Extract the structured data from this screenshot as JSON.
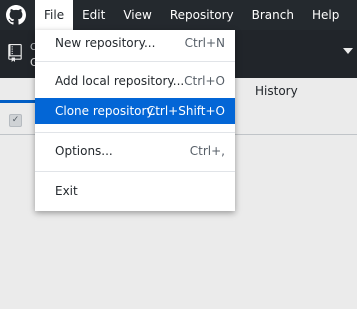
{
  "menubar": {
    "items": [
      {
        "label": "File"
      },
      {
        "label": "Edit"
      },
      {
        "label": "View"
      },
      {
        "label": "Repository"
      },
      {
        "label": "Branch"
      },
      {
        "label": "Help"
      }
    ]
  },
  "toolbar": {
    "repo_label": "C",
    "repo_name": "G"
  },
  "tabs": {
    "history": "History"
  },
  "file_menu": {
    "items": [
      {
        "label": "New repository...",
        "accel": "Ctrl+N"
      },
      {
        "label": "Add local repository...",
        "accel": "Ctrl+O"
      },
      {
        "label": "Clone repository...",
        "accel": "Ctrl+Shift+O"
      },
      {
        "label": "Options...",
        "accel": "Ctrl+,"
      },
      {
        "label": "Exit",
        "accel": ""
      }
    ]
  },
  "colors": {
    "menubar_bg": "#24292e",
    "highlight": "#0366d6"
  }
}
